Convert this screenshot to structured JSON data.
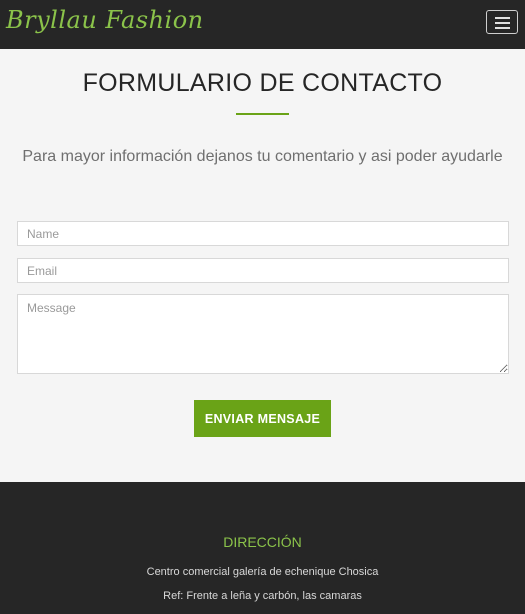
{
  "header": {
    "brand": "Bryllau Fashion",
    "menu_icon": "hamburger-menu-icon"
  },
  "contact": {
    "title": "FORMULARIO DE CONTACTO",
    "subtitle": "Para mayor información dejanos tu comentario y asi poder ayudarle",
    "form": {
      "name_placeholder": "Name",
      "email_placeholder": "Email",
      "message_placeholder": "Message",
      "submit_label": "ENVIAR MENSAJE"
    }
  },
  "footer": {
    "heading": "DIRECCIÓN",
    "address": "Centro comercial galería de echenique Chosica",
    "reference": "Ref: Frente a leña y carbón, las camaras"
  },
  "colors": {
    "accent": "#6aa317",
    "brand_green": "#8bc34a",
    "dark": "#262626",
    "background": "#f5f5f5"
  }
}
